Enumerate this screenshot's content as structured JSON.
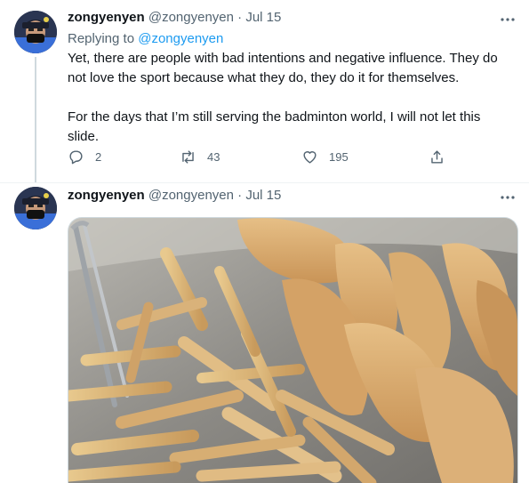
{
  "tweets": [
    {
      "display_name": "zongyenyen",
      "handle": "@zongyenyen",
      "separator": "·",
      "date": "Jul 15",
      "replying_prefix": "Replying to",
      "replying_handle": "@zongyenyen",
      "paragraphs": [
        "Yet, there are people with bad intentions and negative influence. They do not love the sport because what they do, they do it for themselves.",
        "For the days that I’m still serving the badminton world, I will not let this slide."
      ],
      "actions": {
        "reply": {
          "icon": "reply-icon",
          "count": "2"
        },
        "retweet": {
          "icon": "retweet-icon",
          "count": "43"
        },
        "like": {
          "icon": "heart-icon",
          "count": "195"
        },
        "share": {
          "icon": "share-icon"
        }
      }
    },
    {
      "display_name": "zongyenyen",
      "handle": "@zongyenyen",
      "separator": "·",
      "date": "Jul 15",
      "media": {
        "type": "photo"
      }
    }
  ],
  "more_icon": "more-icon",
  "colors": {
    "link": "#1d9bf0",
    "muted": "#536471",
    "text": "#0f1419",
    "divider": "#eff3f4"
  }
}
